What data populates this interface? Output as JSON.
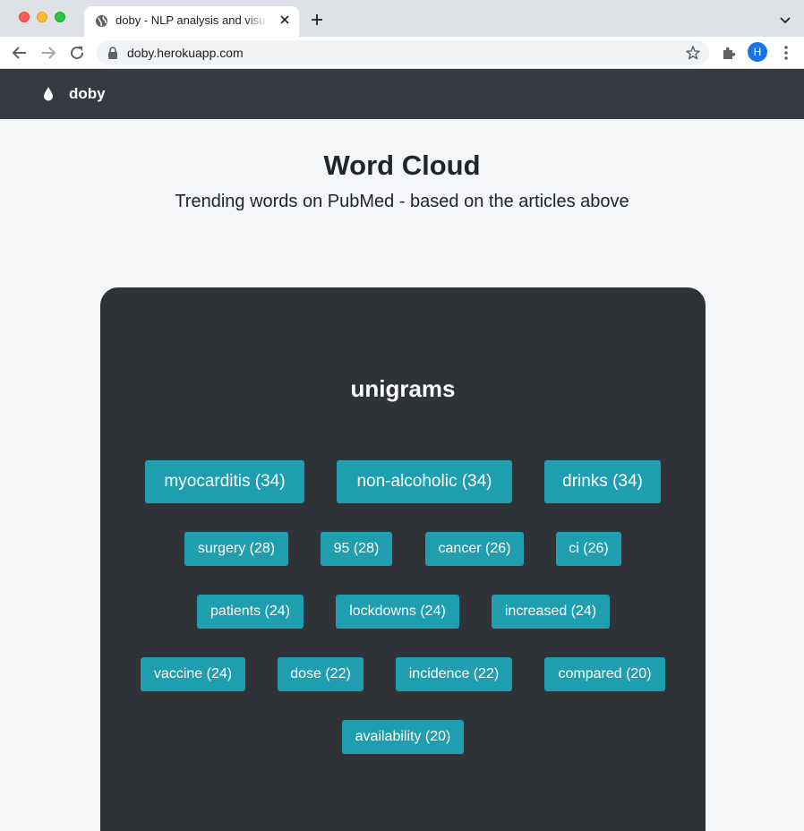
{
  "browser": {
    "tab_title": "doby - NLP analysis and visualization",
    "url": "doby.herokuapp.com",
    "profile_initial": "H"
  },
  "navbar": {
    "brand": "doby"
  },
  "header": {
    "title": "Word Cloud",
    "subtitle": "Trending words on PubMed - based on the articles above"
  },
  "cloud": {
    "title": "unigrams",
    "words": [
      {
        "label": "myocarditis (34)"
      },
      {
        "label": "non-alcoholic (34)"
      },
      {
        "label": "drinks (34)"
      },
      {
        "label": "surgery (28)"
      },
      {
        "label": "95 (28)"
      },
      {
        "label": "cancer (26)"
      },
      {
        "label": "ci (26)"
      },
      {
        "label": "patients (24)"
      },
      {
        "label": "lockdowns (24)"
      },
      {
        "label": "increased (24)"
      },
      {
        "label": "vaccine (24)"
      },
      {
        "label": "dose (22)"
      },
      {
        "label": "incidence (22)"
      },
      {
        "label": "compared (20)"
      },
      {
        "label": "availability (20)"
      }
    ]
  },
  "colors": {
    "navbar": "#343a40",
    "card": "#2f3337",
    "chip": "#1f9eb0",
    "page": "#f5f6f8"
  }
}
